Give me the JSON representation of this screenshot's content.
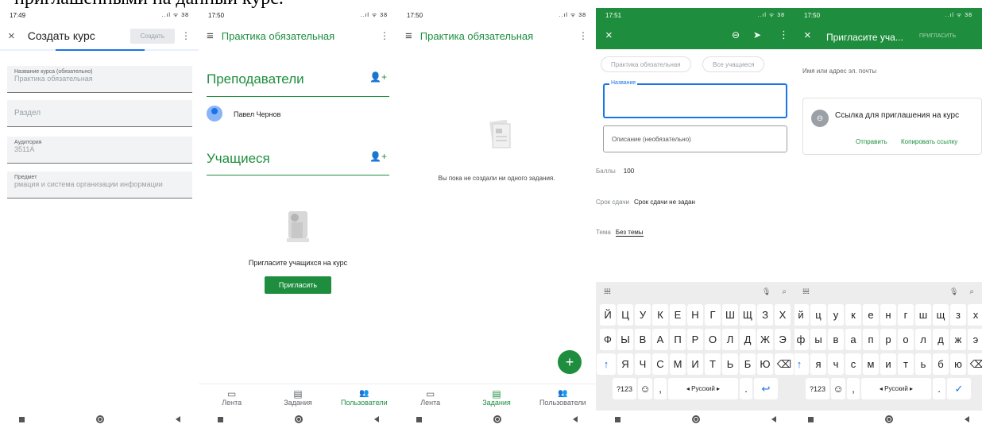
{
  "caption_fragment": "приглашенными на данный курс.",
  "screen1": {
    "time": "17:49",
    "status_icons": "..ıl ᯤ 38",
    "close_icon": "×",
    "title": "Создать курс",
    "create_button": "Создать",
    "more_icon": "⋮",
    "fields": [
      {
        "label": "Название курса (обязательно)",
        "value": "Практика обязательная"
      },
      {
        "label": "",
        "value": "Раздел"
      },
      {
        "label": "Аудитория",
        "value": "3511А"
      },
      {
        "label": "Предмет",
        "value": "рмация и система организации информации"
      }
    ]
  },
  "screen2": {
    "time": "17:50",
    "status_icons": "..ıl ᯤ 38",
    "menu_icon": "≡",
    "title": "Практика обязательная",
    "more_icon": "⋮",
    "teachers_heading": "Преподаватели",
    "teacher_name": "Павел Чернов",
    "students_heading": "Учащиеся",
    "invite_text": "Пригласите учащихся на курс",
    "invite_button": "Пригласить",
    "tabs": [
      {
        "icon": "▭",
        "label": "Лента"
      },
      {
        "icon": "▤",
        "label": "Задания"
      },
      {
        "icon": "👥",
        "label": "Пользователи"
      }
    ]
  },
  "screen3": {
    "time": "17:50",
    "status_icons": "..ıl ᯤ 38",
    "menu_icon": "≡",
    "title": "Практика обязательная",
    "more_icon": "⋮",
    "empty_text": "Вы пока не создали ни одного задания.",
    "fab_label": "+",
    "tabs": [
      {
        "icon": "▭",
        "label": "Лента"
      },
      {
        "icon": "▤",
        "label": "Задания"
      },
      {
        "icon": "👥",
        "label": "Пользователи"
      }
    ]
  },
  "screen4": {
    "time": "17:51",
    "status_icons": "..ıl ᯤ 38",
    "close_icon": "×",
    "attach_icon": "⊖",
    "send_icon": "➤",
    "more_icon": "⋮",
    "chips": [
      "Практика обязательная",
      "Все учащиеся"
    ],
    "name_label": "Название",
    "description_placeholder": "Описание (необязательно)",
    "points_label": "Баллы",
    "points_value": "100",
    "due_label": "Срок сдачи",
    "due_value": "Срок сдачи не задан",
    "topic_label": "Тема",
    "topic_value": "Без темы"
  },
  "screen5": {
    "time": "17:50",
    "status_icons": "..ıl ᯤ 38",
    "close_icon": "×",
    "title": "Пригласите уча...",
    "invite_button": "ПРИГЛАСИТЬ",
    "email_placeholder": "Имя или адрес эл. почты",
    "link_title": "Ссылка для приглашения на курс",
    "send_link": "Отправить",
    "copy_link": "Копировать ссылку"
  },
  "keyboard": {
    "grid_icon": "𝍐",
    "mic_icon": "🎙",
    "search_icon": "⌕",
    "row1": [
      "й",
      "ц",
      "у",
      "к",
      "е",
      "н",
      "г",
      "ш",
      "щ",
      "з",
      "х"
    ],
    "row2": [
      "ф",
      "ы",
      "в",
      "а",
      "п",
      "р",
      "о",
      "л",
      "д",
      "ж",
      "э"
    ],
    "row3": [
      "я",
      "ч",
      "с",
      "м",
      "и",
      "т",
      "ь",
      "б",
      "ю"
    ],
    "shift": "↑",
    "backspace": "⌫",
    "num": "?123",
    "emoji": "☺",
    "comma": ",",
    "space": "◂ Русский ▸",
    "dot": ".",
    "enter": "↩",
    "check": "✓"
  }
}
